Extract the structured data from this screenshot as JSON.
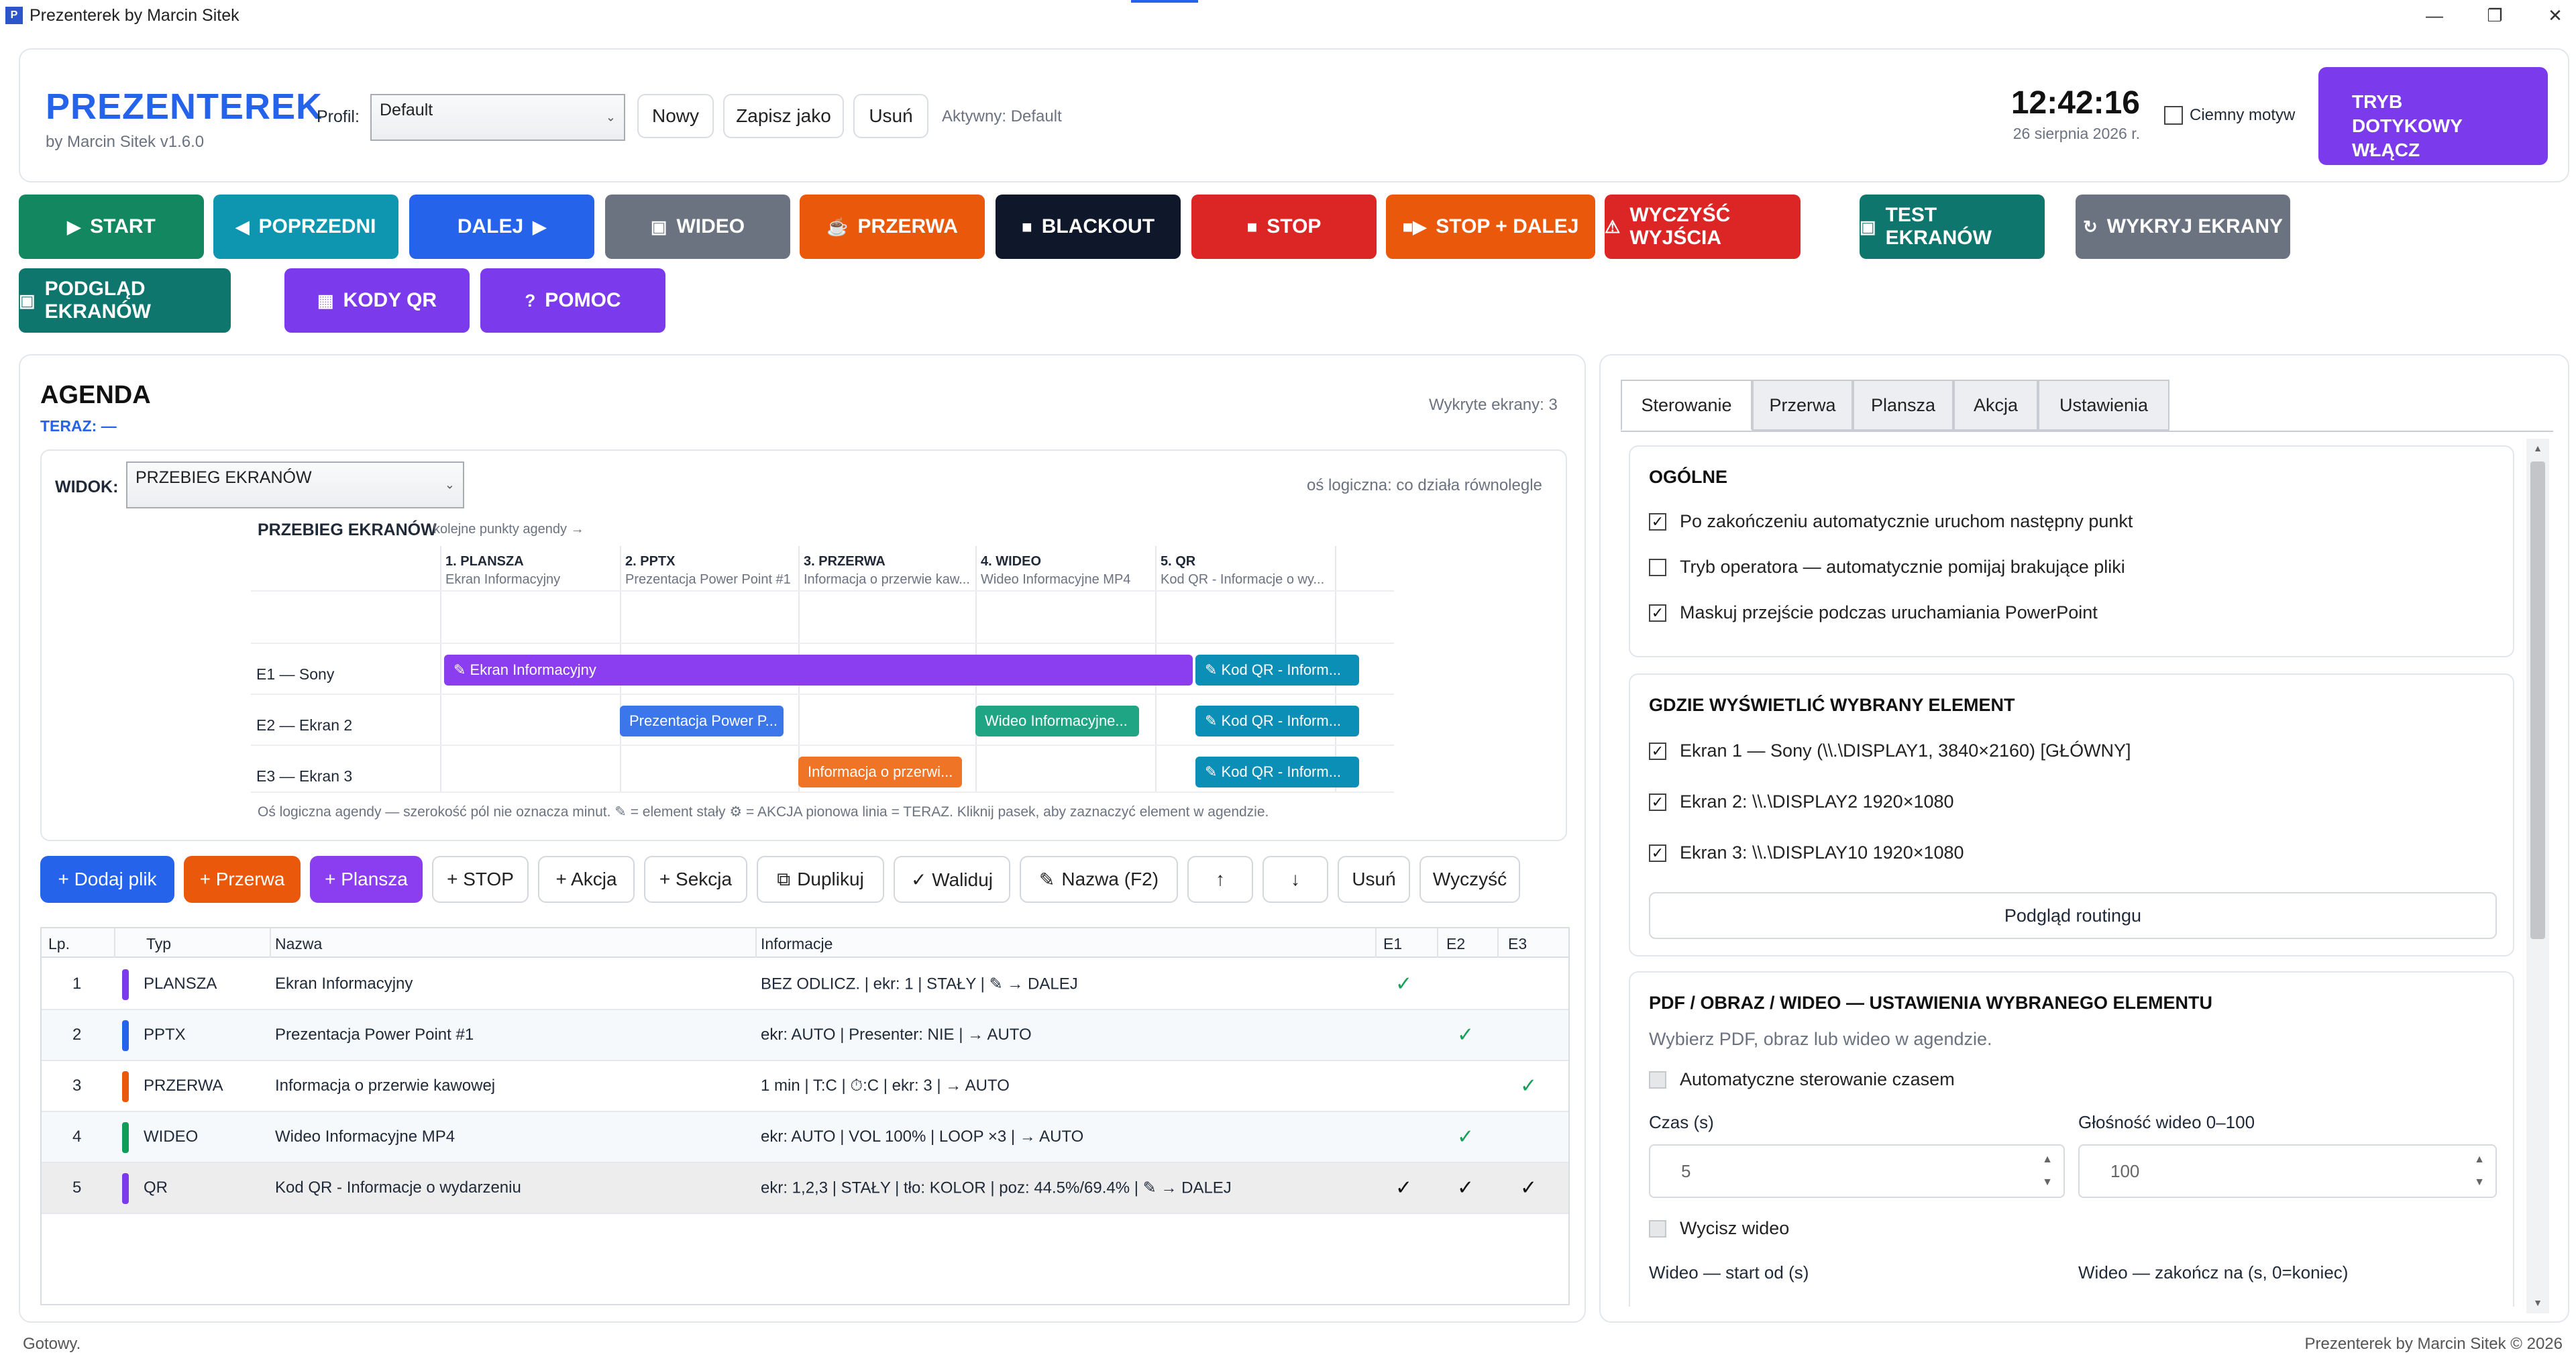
{
  "window": {
    "title": "Prezenterek by Marcin Sitek",
    "app_icon": "P"
  },
  "header": {
    "brand": "PREZENTEREK",
    "subtitle": "by Marcin Sitek v1.6.0",
    "profile_label": "Profil:",
    "profile_value": "Default",
    "new_label": "Nowy",
    "save_as_label": "Zapisz jako",
    "delete_label": "Usuń",
    "active_text": "Aktywny: Default",
    "clock": "12:42:16",
    "date": "26 sierpnia 2026 r.",
    "dark_theme_label": "Ciemny motyw",
    "touch_mode_label": "TRYB DOTYKOWY WŁĄCZ"
  },
  "toolbar": {
    "buttons": [
      {
        "label": "START",
        "icon": "▶",
        "color": "#13875f"
      },
      {
        "label": "POPRZEDNI",
        "icon": "◀",
        "color": "#0e95b0"
      },
      {
        "label": "DALEJ",
        "icon": "▶",
        "color": "#2563eb"
      },
      {
        "label": "WIDEO",
        "icon": "▣",
        "color": "#6b7280"
      },
      {
        "label": "PRZERWA",
        "icon": "☕",
        "color": "#ea580c"
      },
      {
        "label": "BLACKOUT",
        "icon": "■",
        "color": "#0f172a"
      },
      {
        "label": "STOP",
        "icon": "■",
        "color": "#dc2626"
      },
      {
        "label": "STOP + DALEJ",
        "icon": "■▶",
        "color": "#ea580c"
      },
      {
        "label": "WYCZYŚĆ WYJŚCIA",
        "icon": "⚠",
        "color": "#dc2626"
      },
      {
        "label": "TEST EKRANÓW",
        "icon": "▣",
        "color": "#0f766e"
      },
      {
        "label": "WYKRYJ EKRANY",
        "icon": "↻",
        "color": "#6b7280"
      },
      {
        "label": "PODGLĄD EKRANÓW",
        "icon": "▣",
        "color": "#0f766e"
      },
      {
        "label": "KODY QR",
        "icon": "▦",
        "color": "#7c3aed"
      },
      {
        "label": "POMOC",
        "icon": "?",
        "color": "#7c3aed"
      }
    ]
  },
  "agenda": {
    "title": "AGENDA",
    "now": "TERAZ: —",
    "screens_detected": "Wykryte ekrany: 3",
    "view_label": "WIDOK:",
    "view_value": "PRZEBIEG EKRANÓW",
    "axis_note": "oś logiczna: co działa równolegle",
    "timeline_title": "PRZEBIEG EKRANÓW",
    "timeline_hint": "kolejne punkty agendy →",
    "columns": [
      {
        "title": "1. PLANSZA",
        "sub": "Ekran Informacyjny"
      },
      {
        "title": "2. PPTX",
        "sub": "Prezentacja Power Point #1"
      },
      {
        "title": "3. PRZERWA",
        "sub": "Informacja o przerwie kaw..."
      },
      {
        "title": "4. WIDEO",
        "sub": "Wideo Informacyjne MP4"
      },
      {
        "title": "5. QR",
        "sub": "Kod QR - Informacje o wy..."
      }
    ],
    "rows": [
      "E1 — Sony",
      "E2 — Ekran 2",
      "E3 — Ekran 3"
    ],
    "bars": {
      "e1_plansza": "Ekran Informacyjny",
      "e1_qr": "Kod QR - Inform...",
      "e2_pptx": "Prezentacja Power P...",
      "e2_video": "Wideo Informacyjne...",
      "e2_qr": "Kod QR - Inform...",
      "e3_break": "Informacja o przerwi...",
      "e3_qr": "Kod QR - Inform..."
    },
    "legend": "Oś logiczna agendy — szerokość pól nie oznacza minut.  ✎ = element stały   ⚙ = AKCJA   pionowa linia = TERAZ.  Kliknij pasek, aby zaznaczyć element w agendzie.",
    "actions": {
      "add_file": "+ Dodaj plik",
      "break": "+ Przerwa",
      "board": "+ Plansza",
      "stop": "+ STOP",
      "action": "+ Akcja",
      "section": "+ Sekcja",
      "duplicate": "Duplikuj",
      "validate": "✓ Waliduj",
      "rename": "Nazwa (F2)",
      "up": "↑",
      "down": "↓",
      "remove": "Usuń",
      "clear": "Wyczyść"
    },
    "table": {
      "headers": [
        "Lp.",
        "Typ",
        "Nazwa",
        "Informacje",
        "E1",
        "E2",
        "E3"
      ],
      "rows": [
        {
          "n": "1",
          "type": "PLANSZA",
          "color": "#7c3aed",
          "name": "Ekran Informacyjny",
          "info": "BEZ ODLICZ. | ekr: 1 | STAŁY | ✎ → DALEJ",
          "e1": "✓",
          "e2": "",
          "e3": ""
        },
        {
          "n": "2",
          "type": "PPTX",
          "color": "#2563eb",
          "name": "Prezentacja Power Point #1",
          "info": "ekr: AUTO | Presenter: NIE | → AUTO",
          "e1": "",
          "e2": "✓",
          "e3": ""
        },
        {
          "n": "3",
          "type": "PRZERWA",
          "color": "#ea580c",
          "name": "Informacja o przerwie kawowej",
          "info": "1 min | T:C | ⏱:C | ekr: 3 | → AUTO",
          "e1": "",
          "e2": "",
          "e3": "✓"
        },
        {
          "n": "4",
          "type": "WIDEO",
          "color": "#0f9d58",
          "name": "Wideo Informacyjne MP4",
          "info": "ekr: AUTO | VOL 100% | LOOP ×3 | → AUTO",
          "e1": "",
          "e2": "✓",
          "e3": ""
        },
        {
          "n": "5",
          "type": "QR",
          "color": "#7c3aed",
          "name": "Kod QR - Informacje o wydarzeniu",
          "info": "ekr: 1,2,3 | STAŁY | tło: KOLOR | poz: 44.5%/69.4% | ✎ → DALEJ",
          "e1": "✓",
          "e2": "✓",
          "e3": "✓"
        }
      ]
    }
  },
  "right": {
    "tabs": [
      "Sterowanie",
      "Przerwa",
      "Plansza",
      "Akcja",
      "Ustawienia"
    ],
    "general_title": "OGÓLNE",
    "general_opts": [
      {
        "label": "Po zakończeniu automatycznie uruchom następny punkt",
        "checked": "✓"
      },
      {
        "label": "Tryb operatora — automatycznie pomijaj brakujące pliki",
        "checked": ""
      },
      {
        "label": "Maskuj przejście podczas uruchamiania PowerPoint",
        "checked": "✓"
      }
    ],
    "where_title": "GDZIE WYŚWIETLIĆ WYBRANY ELEMENT",
    "where_opts": [
      {
        "label": "Ekran 1 — Sony  (\\\\.\\DISPLAY1, 3840×2160) [GŁÓWNY]",
        "checked": "✓"
      },
      {
        "label": "Ekran 2: \\\\.\\DISPLAY2  1920×1080",
        "checked": "✓"
      },
      {
        "label": "Ekran 3: \\\\.\\DISPLAY10  1920×1080",
        "checked": "✓"
      }
    ],
    "routing_preview": "Podgląd routingu",
    "media_title": "PDF / OBRAZ / WIDEO — USTAWIENIA WYBRANEGO ELEMENTU",
    "media_hint": "Wybierz PDF, obraz lub wideo w agendzie.",
    "auto_time": "Automatyczne sterowanie czasem",
    "time_label": "Czas (s)",
    "time_value": "5",
    "volume_label": "Głośność wideo 0–100",
    "volume_value": "100",
    "mute_label": "Wycisz wideo",
    "start_label": "Wideo — start od (s)",
    "end_label": "Wideo — zakończ na (s, 0=koniec)"
  },
  "status": {
    "left": "Gotowy.",
    "right": "Prezenterek by Marcin Sitek © 2026"
  }
}
